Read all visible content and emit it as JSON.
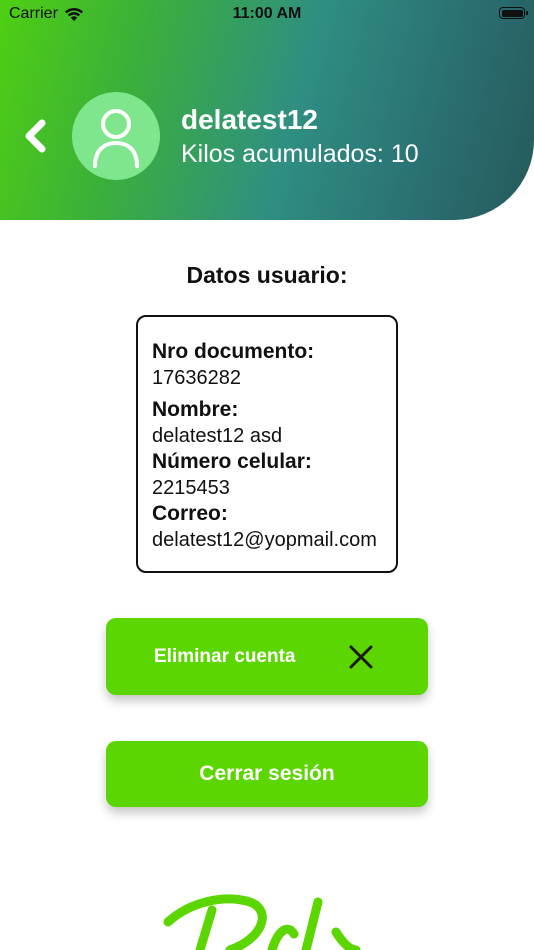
{
  "status_bar": {
    "carrier": "Carrier",
    "time": "11:00 AM"
  },
  "profile": {
    "username": "delatest12",
    "kilos": "Kilos acumulados: 10"
  },
  "section_title": "Datos usuario:",
  "user_data": {
    "document_label": "Nro documento:",
    "document_value": "17636282",
    "name_label": "Nombre:",
    "name_value": "delatest12 asd",
    "phone_label": "Número celular:",
    "phone_value": "2215453",
    "email_label": "Correo:",
    "email_value": "delatest12@yopmail.com"
  },
  "buttons": {
    "delete_account": "Eliminar cuenta",
    "logout": "Cerrar sesión"
  },
  "icons": {
    "back": "chevron-left-icon",
    "avatar": "user-icon",
    "delete": "close-icon",
    "wifi": "wifi-icon",
    "battery": "battery-icon"
  },
  "colors": {
    "accent_green": "#5cd600",
    "avatar_bg": "#7fe68e",
    "header_start": "#4fcf12",
    "header_end": "#265a5a"
  }
}
